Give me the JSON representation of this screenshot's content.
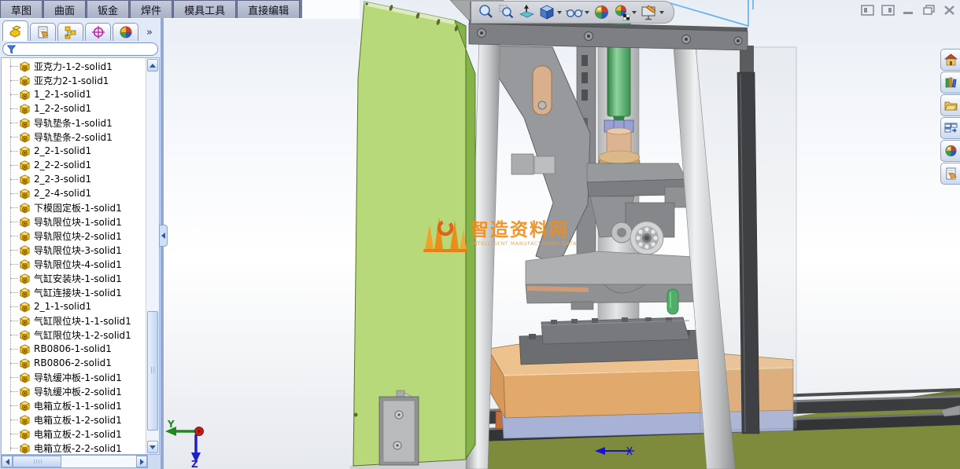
{
  "tab_bar": {
    "tabs": [
      "草图",
      "曲面",
      "钣金",
      "焊件",
      "模具工具",
      "直接编辑"
    ],
    "active_tab": "草图"
  },
  "left_panel": {
    "manager_tab_icons": [
      "featuremanager-tree-icon",
      "propertymanager-icon",
      "configurationmanager-icon",
      "dimxpertmanager-icon",
      "displaymanager-icon"
    ],
    "overflow_chevron": "»",
    "filter": {
      "value": "",
      "placeholder": ""
    },
    "tree_items": [
      "亚克力-1-2-solid1",
      "亚克力2-1-solid1",
      "1_2-1-solid1",
      "1_2-2-solid1",
      "导轨垫条-1-solid1",
      "导轨垫条-2-solid1",
      "2_2-1-solid1",
      "2_2-2-solid1",
      "2_2-3-solid1",
      "2_2-4-solid1",
      "下模固定板-1-solid1",
      "导轨限位块-1-solid1",
      "导轨限位块-2-solid1",
      "导轨限位块-3-solid1",
      "导轨限位块-4-solid1",
      "气缸安装块-1-solid1",
      "气缸连接块-1-solid1",
      "2_1-1-solid1",
      "气缸限位块-1-1-solid1",
      "气缸限位块-1-2-solid1",
      "RB0806-1-solid1",
      "RB0806-2-solid1",
      "导轨缓冲板-1-solid1",
      "导轨缓冲板-2-solid1",
      "电箱立板-1-1-solid1",
      "电箱立板-1-2-solid1",
      "电箱立板-2-1-solid1",
      "电箱立板-2-2-solid1"
    ]
  },
  "headsup_toolbar": {
    "icons": [
      "zoom-to-fit",
      "zoom-to-area",
      "section-view",
      "view-orientation",
      "display-style",
      "apply-scene",
      "view-settings",
      "edit-scene"
    ]
  },
  "window_controls": [
    "collapse-left-pane",
    "collapse-right-pane",
    "minimize",
    "restore",
    "close"
  ],
  "task_pane": {
    "icons": [
      "solidworks-resources-home",
      "design-library",
      "file-explorer",
      "view-palette",
      "appearances-scenes",
      "custom-properties"
    ]
  },
  "viewport": {
    "watermark_title": "智造资料网",
    "watermark_subtitle": "INTELLIGENT MANUFACTURING DATA",
    "triad": {
      "y_label": "Y",
      "z_label": "Z"
    }
  },
  "colors": {
    "panel_green": "#b7d97a",
    "base_olive": "#7e8b3d",
    "box_orange": "#e2a96d",
    "plate_lavender": "#a8b2d6",
    "cylinder_green": "#47a45c",
    "watermark_orange": "#f08c1a",
    "selection_blue": "#5ab0f2",
    "panel_chrome_blue": "#cddcf1"
  }
}
